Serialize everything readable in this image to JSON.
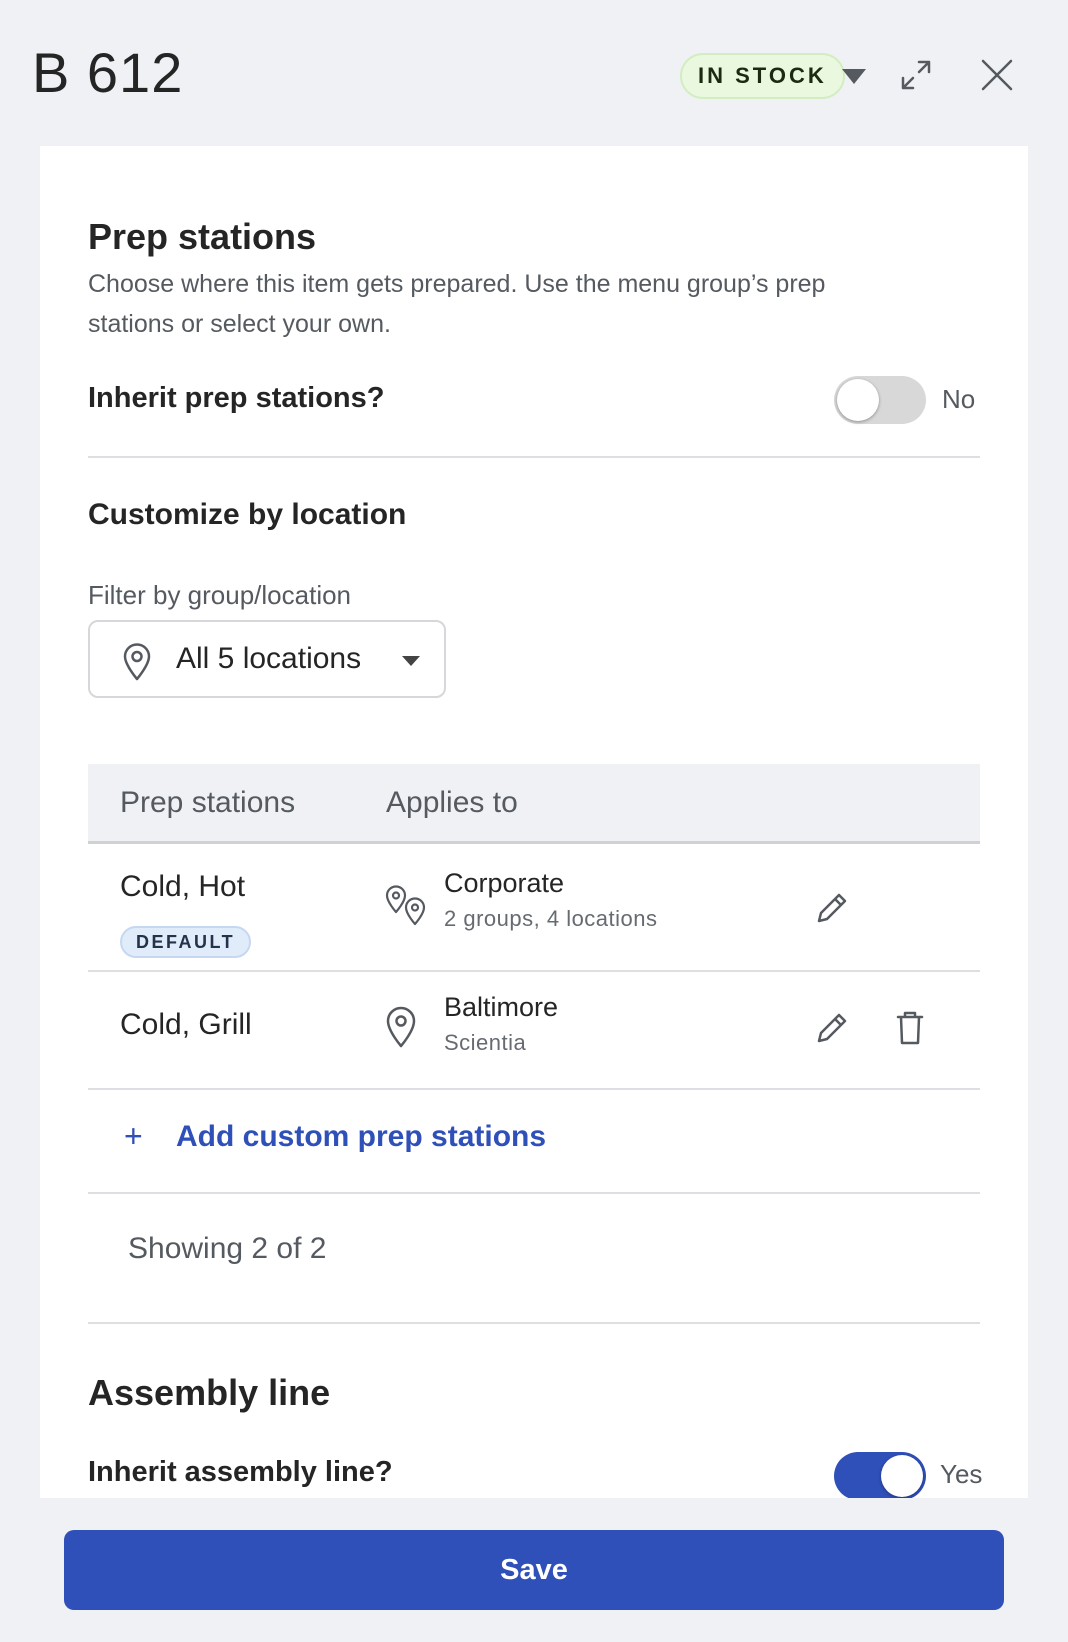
{
  "header": {
    "title": "B 612",
    "stock_status": "IN STOCK"
  },
  "prep": {
    "title": "Prep stations",
    "description": "Choose where this item gets prepared. Use the menu group’s prep stations or select your own.",
    "inherit_label": "Inherit prep stations?",
    "inherit_value": "No",
    "customize_title": "Customize by location",
    "filter_label": "Filter by group/location",
    "filter_value": "All 5 locations",
    "table": {
      "columns": [
        "Prep stations",
        "Applies to"
      ],
      "rows": [
        {
          "stations": "Cold, Hot",
          "badge": "DEFAULT",
          "applies_to": "Corporate",
          "applies_sub": "2 groups, 4 locations",
          "icon": "multi-location-pin-icon",
          "deletable": false
        },
        {
          "stations": "Cold, Grill",
          "badge": "",
          "applies_to": "Baltimore",
          "applies_sub": "Scientia",
          "icon": "location-pin-icon",
          "deletable": true
        }
      ]
    },
    "add_label": "Add custom prep stations",
    "showing": "Showing 2 of 2"
  },
  "assembly": {
    "title": "Assembly line",
    "inherit_label": "Inherit assembly line?",
    "inherit_value": "Yes"
  },
  "footer": {
    "save_label": "Save"
  },
  "colors": {
    "primary": "#2f4fb9",
    "stock_badge_bg": "#eaf8df",
    "default_badge_bg": "#e0ecfa",
    "page_bg": "#f0f1f4"
  }
}
